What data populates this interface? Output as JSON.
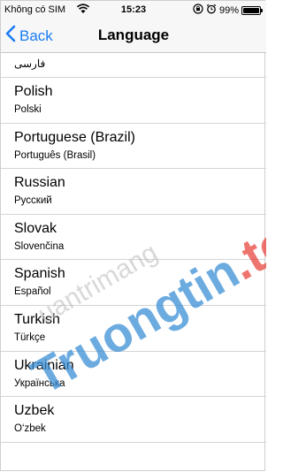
{
  "status_bar": {
    "carrier": "Không có SIM",
    "time": "15:23",
    "battery": "99%",
    "battery_level": 0.99
  },
  "nav": {
    "back_label": "Back",
    "title": "Language"
  },
  "list": {
    "top_partial": "فارسی",
    "items": [
      {
        "name": "Polish",
        "native": "Polski"
      },
      {
        "name": "Portuguese (Brazil)",
        "native": "Português (Brasil)"
      },
      {
        "name": "Russian",
        "native": "Русский"
      },
      {
        "name": "Slovak",
        "native": "Slovenčina"
      },
      {
        "name": "Spanish",
        "native": "Español"
      },
      {
        "name": "Turkish",
        "native": "Türkçe"
      },
      {
        "name": "Ukrainian",
        "native": "Українська"
      },
      {
        "name": "Uzbek",
        "native": "O‘zbek"
      }
    ]
  },
  "watermark": {
    "line1": "uantrimang",
    "line2": "Truongtin",
    "line2_suffix": ".top",
    "colors": {
      "primary": "#3b8fd6",
      "accent": "#e9473f",
      "light": "#bfbfbf"
    }
  },
  "colors": {
    "accent": "#1a7cf2",
    "separator": "#d4d4d4"
  }
}
